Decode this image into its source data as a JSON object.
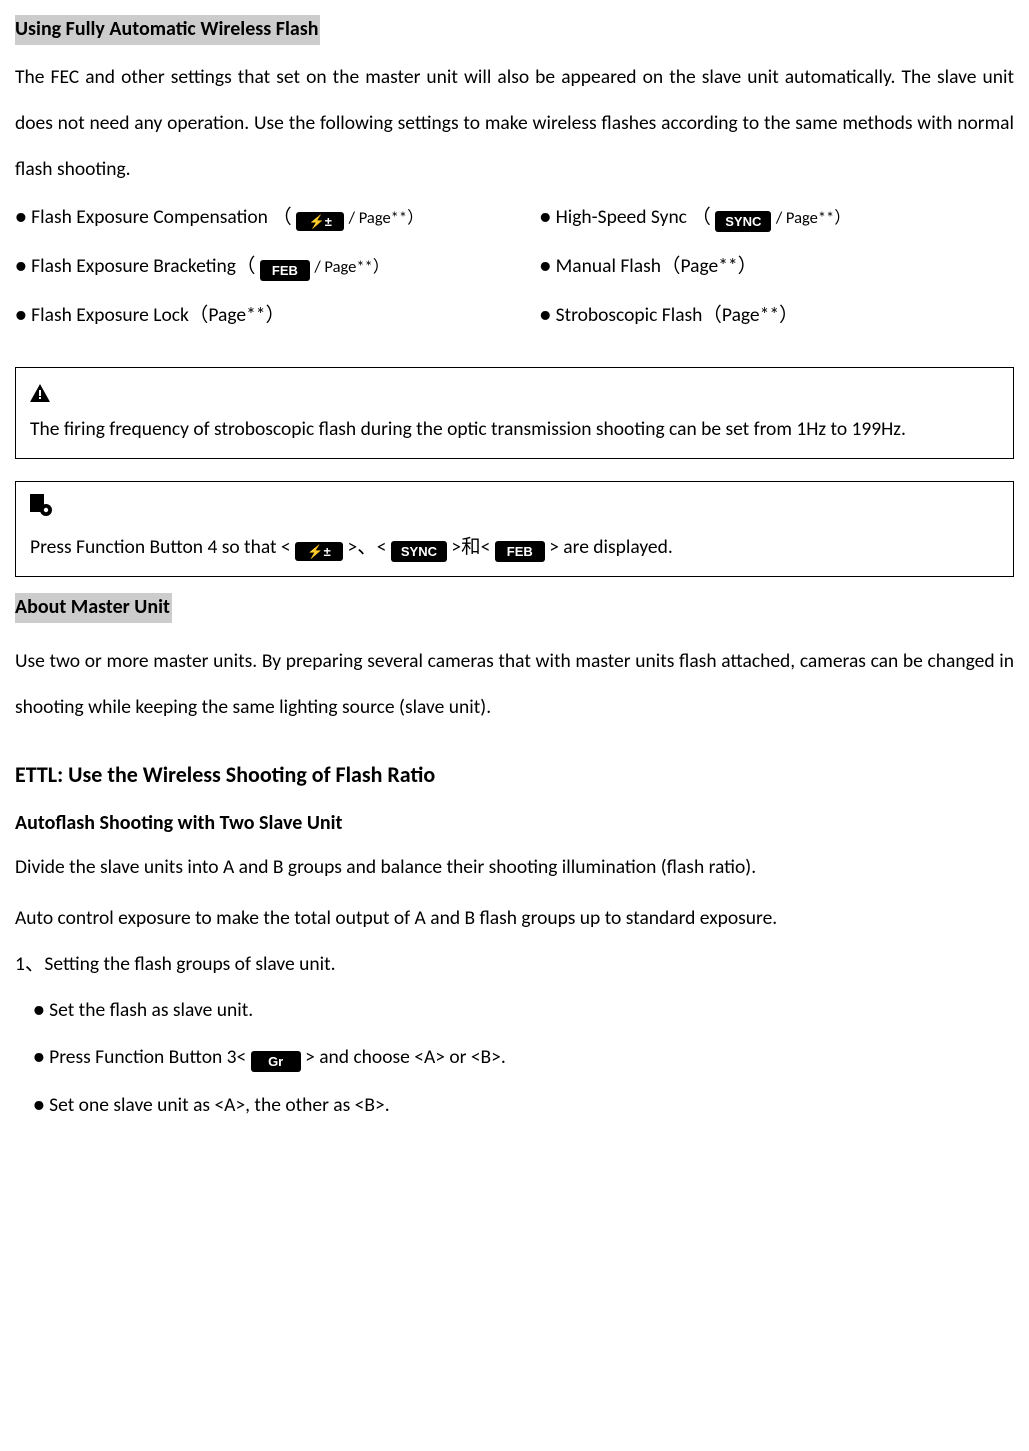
{
  "section1": {
    "title": "Using Fully Automatic Wireless Flash",
    "intro": "The FEC and other settings that set on the master unit will also be appeared on the slave unit automatically. The slave unit does not need any operation. Use the following settings to make wireless flashes according to the same methods with normal flash shooting.",
    "left": {
      "fec_pre": "● Flash Exposure Compensation （",
      "fec_icon": "⚡±",
      "fec_post": "/ Page**）",
      "feb_pre": "● Flash Exposure Bracketing（",
      "feb_icon": "FEB",
      "feb_post": "/ Page**）",
      "fel": "● Flash Exposure Lock（Page**）"
    },
    "right": {
      "hss_pre": "● High-Speed Sync （",
      "hss_icon": "SYNC",
      "hss_post": "/ Page**）",
      "man": "● Manual Flash（Page**）",
      "strobo": "● Stroboscopic Flash（Page**）"
    }
  },
  "box1": {
    "text": "The firing frequency of stroboscopic flash during the optic transmission shooting can be set from 1Hz to 199Hz."
  },
  "box2": {
    "pre": "Press Function Button 4 so that <",
    "i1": "⚡±",
    "mid1": ">、<",
    "i2": "SYNC",
    "mid2": ">和<",
    "i3": "FEB",
    "post": "> are displayed."
  },
  "section2": {
    "title": "About Master Unit",
    "body": "Use two or more master units. By preparing several cameras that with master units flash attached, cameras can be changed in shooting while keeping the same lighting source (slave unit)."
  },
  "section3": {
    "title": "ETTL: Use the Wireless Shooting of Flash Ratio",
    "subtitle": "Autoflash Shooting with Two Slave Unit",
    "p1": "Divide the slave units into A and B groups and balance their shooting illumination (flash ratio).",
    "p2": "Auto control exposure to make the total output of A and B flash groups up to standard exposure.",
    "step1": "1、Setting the flash groups of slave unit.",
    "sub1": "● Set the flash as slave unit.",
    "sub2_pre": "● Press Function Button 3<",
    "sub2_icon": "Gr",
    "sub2_post": "> and choose <A> or <B>.",
    "sub3": "● Set one slave unit as <A>, the other as <B>."
  }
}
